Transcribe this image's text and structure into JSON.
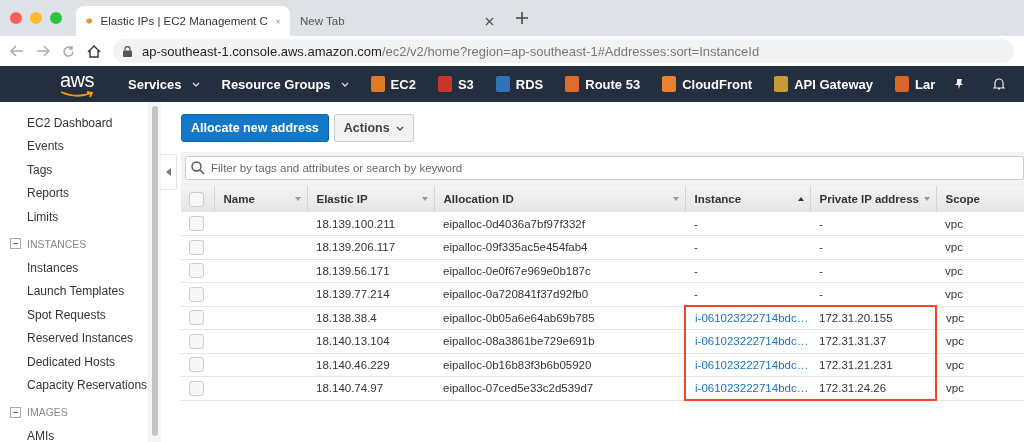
{
  "browser": {
    "tabs": [
      {
        "title": "Elastic IPs | EC2 Management C",
        "selected": true,
        "favicon": true
      },
      {
        "title": "New Tab",
        "selected": false,
        "favicon": false
      }
    ],
    "url": {
      "host": "ap-southeast-1.console.aws.amazon.com",
      "path": "/ec2/v2/home?region=ap-southeast-1#Addresses:sort=InstanceId"
    }
  },
  "nav": {
    "logo": "aws",
    "items": [
      {
        "label": "Services",
        "kind": "menu"
      },
      {
        "label": "Resource Groups",
        "kind": "menu"
      },
      {
        "label": "EC2",
        "kind": "service",
        "color": "#e07b24"
      },
      {
        "label": "S3",
        "kind": "service",
        "color": "#c7352b"
      },
      {
        "label": "RDS",
        "kind": "service",
        "color": "#2e73b8"
      },
      {
        "label": "Route 53",
        "kind": "service",
        "color": "#e06b2a"
      },
      {
        "label": "CloudFront",
        "kind": "service",
        "color": "#e8822c"
      },
      {
        "label": "API Gateway",
        "kind": "service",
        "color": "#c79a32"
      },
      {
        "label": "Lar",
        "kind": "service",
        "color": "#d9672a"
      }
    ]
  },
  "sidebar": [
    {
      "kind": "item",
      "label": "EC2 Dashboard"
    },
    {
      "kind": "item",
      "label": "Events"
    },
    {
      "kind": "item",
      "label": "Tags"
    },
    {
      "kind": "item",
      "label": "Reports"
    },
    {
      "kind": "item",
      "label": "Limits"
    },
    {
      "kind": "group",
      "label": "INSTANCES",
      "expanded": true,
      "children": [
        {
          "label": "Instances"
        },
        {
          "label": "Launch Templates"
        },
        {
          "label": "Spot Requests"
        },
        {
          "label": "Reserved Instances"
        },
        {
          "label": "Dedicated Hosts"
        },
        {
          "label": "Capacity Reservations"
        }
      ]
    },
    {
      "kind": "group",
      "label": "IMAGES",
      "expanded": true,
      "children": [
        {
          "label": "AMIs"
        }
      ]
    }
  ],
  "toolbar": {
    "primary": "Allocate new address",
    "actions": "Actions"
  },
  "filter": {
    "placeholder": "Filter by tags and attributes or search by keyword"
  },
  "table": {
    "all_checked": false,
    "columns": [
      {
        "label": "Name",
        "sortable": true,
        "sorted": false
      },
      {
        "label": "Elastic IP",
        "sortable": true,
        "sorted": false
      },
      {
        "label": "Allocation ID",
        "sortable": true,
        "sorted": false
      },
      {
        "label": "Instance",
        "sortable": true,
        "sorted": true
      },
      {
        "label": "Private IP address",
        "sortable": true,
        "sorted": false
      },
      {
        "label": "Scope",
        "sortable": false
      }
    ],
    "rows": [
      {
        "checked": false,
        "highlighted": false,
        "elastic_ip": "18.139.100.211",
        "allocation_id": "eipalloc-0d4036a7bf97f332f",
        "instance": "-",
        "private_ip": "-",
        "scope": "vpc"
      },
      {
        "checked": false,
        "highlighted": false,
        "elastic_ip": "18.139.206.117",
        "allocation_id": "eipalloc-09f335ac5e454fab4",
        "instance": "-",
        "private_ip": "-",
        "scope": "vpc"
      },
      {
        "checked": false,
        "highlighted": false,
        "elastic_ip": "18.139.56.171",
        "allocation_id": "eipalloc-0e0f67e969e0b187c",
        "instance": "-",
        "private_ip": "-",
        "scope": "vpc"
      },
      {
        "checked": false,
        "highlighted": false,
        "elastic_ip": "18.139.77.214",
        "allocation_id": "eipalloc-0a720841f37d92fb0",
        "instance": "-",
        "private_ip": "-",
        "scope": "vpc"
      },
      {
        "checked": false,
        "highlighted": true,
        "elastic_ip": "18.138.38.4",
        "allocation_id": "eipalloc-0b05a6e64ab69b785",
        "instance": "i-061023222714bdc…",
        "private_ip": "172.31.20.155",
        "scope": "vpc"
      },
      {
        "checked": false,
        "highlighted": true,
        "elastic_ip": "18.140.13.104",
        "allocation_id": "eipalloc-08a3861be729e691b",
        "instance": "i-061023222714bdc…",
        "private_ip": "172.31.31.37",
        "scope": "vpc"
      },
      {
        "checked": false,
        "highlighted": true,
        "elastic_ip": "18.140.46.229",
        "allocation_id": "eipalloc-0b16b83f3b6b05920",
        "instance": "i-061023222714bdc…",
        "private_ip": "172.31.21.231",
        "scope": "vpc"
      },
      {
        "checked": false,
        "highlighted": true,
        "elastic_ip": "18.140.74.97",
        "allocation_id": "eipalloc-07ced5e33c2d539d7",
        "instance": "i-061023222714bdc…",
        "private_ip": "172.31.24.26",
        "scope": "vpc"
      }
    ]
  }
}
